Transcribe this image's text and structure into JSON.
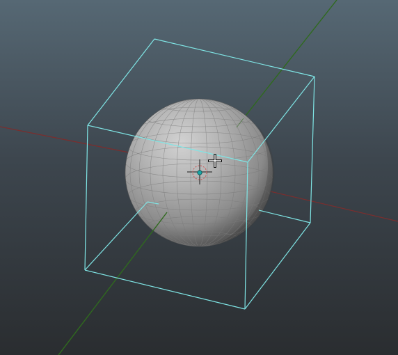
{
  "viewport": {
    "kind": "3d-perspective-viewport",
    "background_top_color": "#566874",
    "background_bottom_color": "#2a2d30"
  },
  "scene": {
    "object": "sphere",
    "object_state": "selected",
    "shading": "faceted-flat",
    "sphere_color": "#a9a9a9",
    "bounding_box_color": "#7fe5e5",
    "axis_x_color": "#7a2e2e",
    "axis_z_color": "#2f6a1e"
  },
  "gizmos": {
    "pivot_manipulator": "pivot-icon",
    "mouse_cursor": "crosshair-cursor-icon"
  }
}
